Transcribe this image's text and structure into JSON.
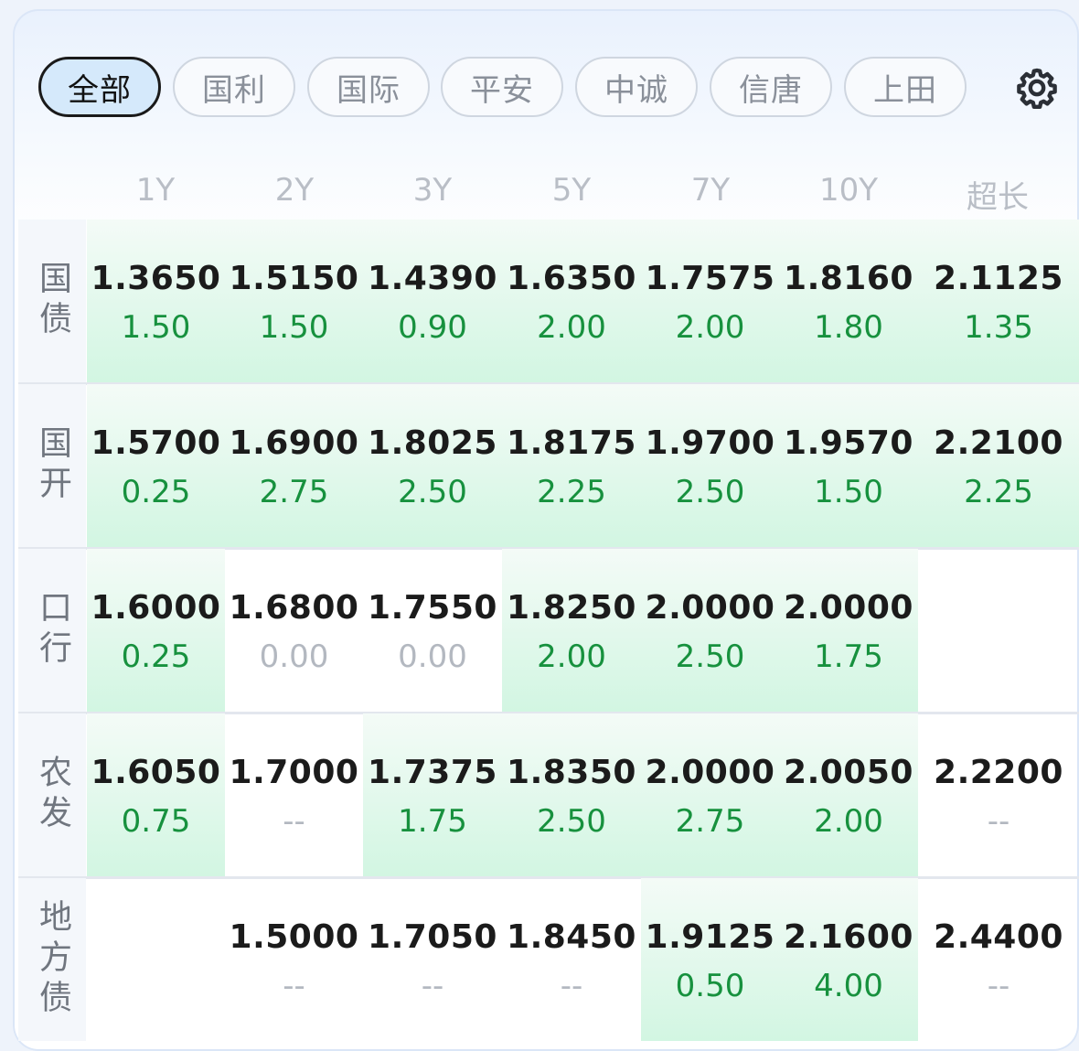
{
  "tabs": [
    {
      "label": "全部",
      "active": true
    },
    {
      "label": "国利",
      "active": false
    },
    {
      "label": "国际",
      "active": false
    },
    {
      "label": "平安",
      "active": false
    },
    {
      "label": "中诚",
      "active": false
    },
    {
      "label": "信唐",
      "active": false
    },
    {
      "label": "上田",
      "active": false
    }
  ],
  "settings_icon": "gear-icon",
  "columns": [
    "1Y",
    "2Y",
    "3Y",
    "5Y",
    "7Y",
    "10Y",
    "超长"
  ],
  "rows": [
    {
      "label": "国债",
      "cells": [
        {
          "value": "1.3650",
          "change": "1.50",
          "highlight": true
        },
        {
          "value": "1.5150",
          "change": "1.50",
          "highlight": true
        },
        {
          "value": "1.4390",
          "change": "0.90",
          "highlight": true
        },
        {
          "value": "1.6350",
          "change": "2.00",
          "highlight": true
        },
        {
          "value": "1.7575",
          "change": "2.00",
          "highlight": true
        },
        {
          "value": "1.8160",
          "change": "1.80",
          "highlight": true
        },
        {
          "value": "2.1125",
          "change": "1.35",
          "highlight": true
        }
      ]
    },
    {
      "label": "国开",
      "cells": [
        {
          "value": "1.5700",
          "change": "0.25",
          "highlight": true
        },
        {
          "value": "1.6900",
          "change": "2.75",
          "highlight": true
        },
        {
          "value": "1.8025",
          "change": "2.50",
          "highlight": true
        },
        {
          "value": "1.8175",
          "change": "2.25",
          "highlight": true
        },
        {
          "value": "1.9700",
          "change": "2.50",
          "highlight": true
        },
        {
          "value": "1.9570",
          "change": "1.50",
          "highlight": true
        },
        {
          "value": "2.2100",
          "change": "2.25",
          "highlight": true
        }
      ]
    },
    {
      "label": "口行",
      "cells": [
        {
          "value": "1.6000",
          "change": "0.25",
          "highlight": true
        },
        {
          "value": "1.6800",
          "change": "0.00",
          "highlight": false
        },
        {
          "value": "1.7550",
          "change": "0.00",
          "highlight": false
        },
        {
          "value": "1.8250",
          "change": "2.00",
          "highlight": true
        },
        {
          "value": "2.0000",
          "change": "2.50",
          "highlight": true
        },
        {
          "value": "2.0000",
          "change": "1.75",
          "highlight": true
        },
        {
          "value": "",
          "change": "",
          "highlight": false
        }
      ]
    },
    {
      "label": "农发",
      "cells": [
        {
          "value": "1.6050",
          "change": "0.75",
          "highlight": true
        },
        {
          "value": "1.7000",
          "change": "--",
          "highlight": false
        },
        {
          "value": "1.7375",
          "change": "1.75",
          "highlight": true
        },
        {
          "value": "1.8350",
          "change": "2.50",
          "highlight": true
        },
        {
          "value": "2.0000",
          "change": "2.75",
          "highlight": true
        },
        {
          "value": "2.0050",
          "change": "2.00",
          "highlight": true
        },
        {
          "value": "2.2200",
          "change": "--",
          "highlight": false
        }
      ]
    },
    {
      "label": "地方债",
      "cells": [
        {
          "value": "",
          "change": "",
          "highlight": false
        },
        {
          "value": "1.5000",
          "change": "--",
          "highlight": false
        },
        {
          "value": "1.7050",
          "change": "--",
          "highlight": false
        },
        {
          "value": "1.8450",
          "change": "--",
          "highlight": false
        },
        {
          "value": "1.9125",
          "change": "0.50",
          "highlight": true
        },
        {
          "value": "2.1600",
          "change": "4.00",
          "highlight": true
        },
        {
          "value": "2.4400",
          "change": "--",
          "highlight": false
        }
      ]
    }
  ]
}
